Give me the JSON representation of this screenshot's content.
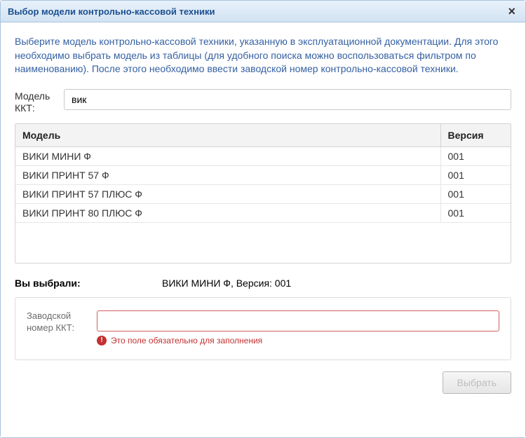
{
  "header": {
    "title": "Выбор модели контрольно-кассовой техники"
  },
  "instructions": "Выберите модель контрольно-кассовой техники, указанную в эксплуатационной документации. Для этого необходимо выбрать модель из таблицы (для удобного поиска можно воспользоваться фильтром по наименованию). После этого необходимо ввести заводской номер контрольно-кассовой техники.",
  "filter": {
    "label": "Модель ККТ:",
    "value": "вик"
  },
  "table": {
    "columns": {
      "model": "Модель",
      "version": "Версия"
    },
    "rows": [
      {
        "model": "ВИКИ МИНИ Ф",
        "version": "001"
      },
      {
        "model": "ВИКИ ПРИНТ 57 Ф",
        "version": "001"
      },
      {
        "model": "ВИКИ ПРИНТ 57 ПЛЮС Ф",
        "version": "001"
      },
      {
        "model": "ВИКИ ПРИНТ 80 ПЛЮС Ф",
        "version": "001"
      }
    ]
  },
  "selected": {
    "label": "Вы выбрали:",
    "value": "ВИКИ МИНИ Ф, Версия: 001"
  },
  "serial": {
    "label": "Заводской номер ККТ:",
    "value": "",
    "error": "Это поле обязательно для заполнения"
  },
  "footer": {
    "select_label": "Выбрать"
  }
}
